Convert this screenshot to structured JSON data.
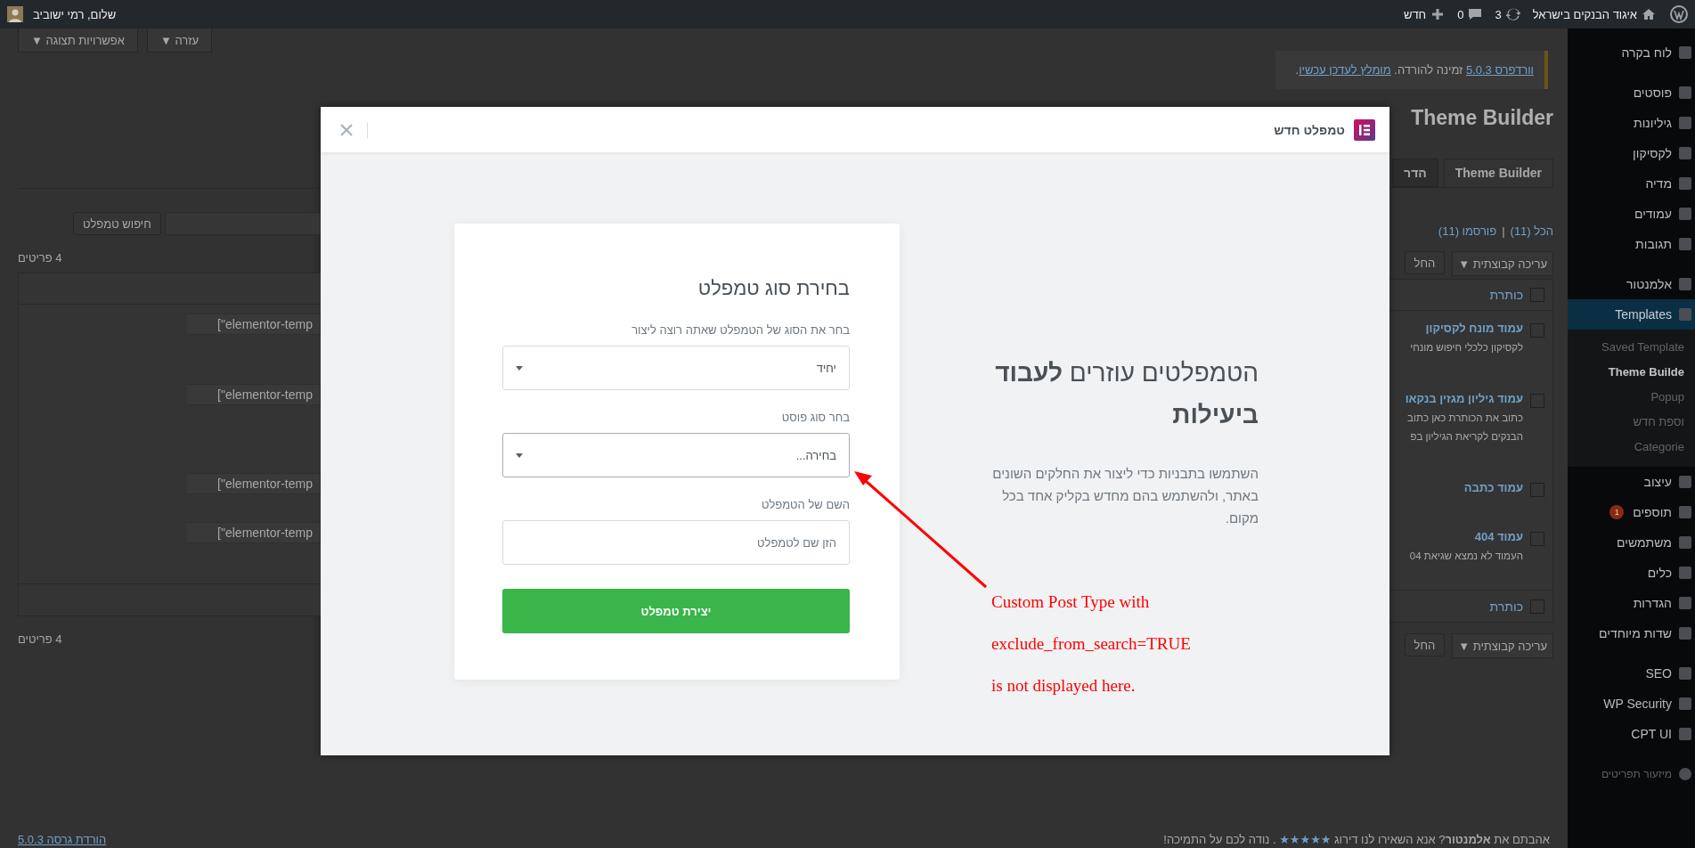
{
  "admin_bar": {
    "site_name": "איגוד הבנקים בישראל",
    "updates": "3",
    "comments": "0",
    "new": "חדש",
    "greeting": "שלום, רמי ישוביב"
  },
  "screen_buttons": [
    "עזרה ▼",
    "אפשרויות תצוגה ▼"
  ],
  "notice": {
    "version_link": "וורדפרס 5.0.3",
    "text": " זמינה להורדה. ",
    "update_link": "מומלץ לעדכן עכשיו",
    "end": "."
  },
  "page_title": "Theme Builder",
  "tabs": [
    {
      "label": "Theme Builder",
      "selected": true
    },
    {
      "label": "הדר",
      "selected": false
    }
  ],
  "filters": {
    "all": "הכל (11)",
    "separator": "|",
    "published": "פורסמו (11)"
  },
  "bulk_top": {
    "select": "עריכה קבוצתית",
    "caret": "▼",
    "apply": "החל"
  },
  "bulk_bottom": {
    "select": "עריכה קבוצתית",
    "caret": "▼",
    "apply": "החל"
  },
  "search": {
    "button": "חיפוש טמפלט"
  },
  "count_top": "4 פריטים",
  "count_bottom": "4 פריטים",
  "table": {
    "column_title": "כותרת",
    "header_checked": false,
    "footer_title": "כותרת",
    "footer_checked": false,
    "rows": [
      {
        "title": "עמוד מונח לקסיקון",
        "description": [
          "לקסיקון כלכלי חיפוש מונחי"
        ],
        "shortcode": "[\"elementor-temp",
        "checked": false
      },
      {
        "title": "עמוד גיליון מגזין בנקאו",
        "description": [
          "כתוב את הכותרת כאן כתוב",
          "הבנקים לקריאת הגיליון בפ"
        ],
        "shortcode": "[\"elementor-temp",
        "checked": false
      },
      {
        "title": "עמוד כתבה",
        "description": [],
        "shortcode": "[\"elementor-temp",
        "checked": false
      },
      {
        "title": "עמוד 404",
        "description": [
          "העמוד לא נמצא שגיאת 04"
        ],
        "shortcode": "[\"elementor-temp",
        "checked": false
      }
    ]
  },
  "footer": {
    "before": "אהבתם את **אלמנטור**? אנא השאירו לנו דירוג ",
    "stars": "★★★★★",
    "after": " . נודה לכם על התמיכה!",
    "version_link": "הורדת גרסה 5.0.3"
  },
  "sidebar": {
    "groups": [
      [
        {
          "label": "לוח בקרה",
          "selected": false
        }
      ],
      [
        {
          "label": "פוסטים",
          "selected": false
        },
        {
          "label": "גיליונות",
          "selected": false
        },
        {
          "label": "לקסיקון",
          "selected": false
        },
        {
          "label": "מדיה",
          "selected": false
        },
        {
          "label": "עמודים",
          "selected": false
        },
        {
          "label": "תגובות",
          "selected": false
        }
      ],
      [
        {
          "label": "אלמנטור",
          "selected": false
        },
        {
          "label": "Templates",
          "selected": true,
          "children": [
            {
              "label": "Saved Template",
              "selected": false
            },
            {
              "label": "Theme Builde",
              "selected": true
            },
            {
              "label": "Popup",
              "selected": false
            },
            {
              "label": "וספת חדש",
              "selected": false
            },
            {
              "label": "Categorie",
              "selected": false
            }
          ]
        },
        {
          "label": "עיצוב",
          "selected": false
        },
        {
          "label": "תוספים",
          "selected": false,
          "badge": "1"
        },
        {
          "label": "משתמשים",
          "selected": false
        },
        {
          "label": "כלים",
          "selected": false
        },
        {
          "label": "הגדרות",
          "selected": false
        },
        {
          "label": "שדות מיוחדים",
          "selected": false
        }
      ],
      [
        {
          "label": "SEO",
          "selected": false
        },
        {
          "label": "WP Security",
          "selected": false
        },
        {
          "label": "CPT UI",
          "selected": false
        }
      ]
    ],
    "collapse": "מיזעור תפריטים"
  },
  "modal": {
    "title": "טמפלט חדש",
    "form": {
      "title": "בחירת סוג טמפלט",
      "fields": [
        {
          "kind": "select",
          "label": "בחר את הסוג של הטמפלט שאתה רוצה ליצור",
          "value": "יחיד",
          "focused": false
        },
        {
          "kind": "select",
          "label": "בחר סוג פוסט",
          "value": "בחירה...",
          "focused": true
        },
        {
          "kind": "text",
          "label": "השם של הטמפלט",
          "placeholder": "הזן שם לטמפלט",
          "focused": false
        }
      ],
      "submit": "יצירת טמפלט"
    },
    "intro": {
      "heading": "הטמפלטים עוזרים **לעבוד ביעילות**",
      "text": "השתמשו בתבניות כדי ליצור את החלקים השונים באתר, ולהשתמש בהם מחדש בקליק אחד בכל מקום."
    }
  },
  "annotation": {
    "lines": [
      "Custom Post Type with",
      "exclude_from_search=TRUE",
      "is not displayed here."
    ]
  }
}
